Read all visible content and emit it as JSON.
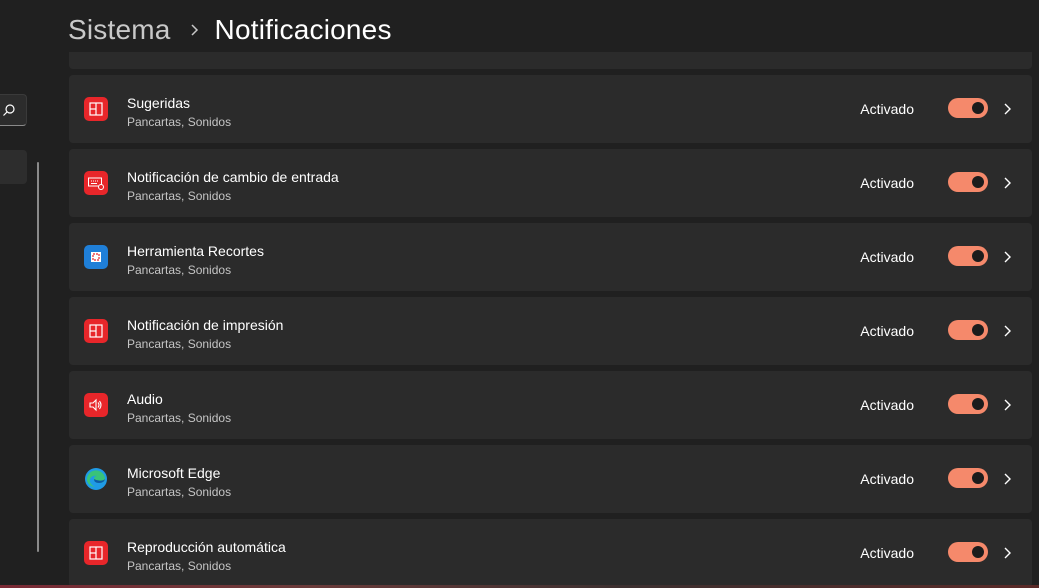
{
  "header": {
    "parent": "Sistema",
    "current": "Notificaciones"
  },
  "nav": {
    "search_icon": "search-icon"
  },
  "apps": [
    {
      "name": "Sugeridas",
      "detail": "Pancartas, Sonidos",
      "state": "Activado",
      "enabled": true,
      "icon": "suggested-icon",
      "icon_color": "#e8262a"
    },
    {
      "name": "Notificación de cambio de entrada",
      "detail": "Pancartas, Sonidos",
      "state": "Activado",
      "enabled": true,
      "icon": "keyboard-settings-icon",
      "icon_color": "#e8262a"
    },
    {
      "name": "Herramienta Recortes",
      "detail": "Pancartas, Sonidos",
      "state": "Activado",
      "enabled": true,
      "icon": "snipping-tool-icon",
      "icon_color": "#1f7fd8"
    },
    {
      "name": "Notificación de impresión",
      "detail": "Pancartas, Sonidos",
      "state": "Activado",
      "enabled": true,
      "icon": "print-notification-icon",
      "icon_color": "#e8262a"
    },
    {
      "name": "Audio",
      "detail": "Pancartas, Sonidos",
      "state": "Activado",
      "enabled": true,
      "icon": "speaker-icon",
      "icon_color": "#e8262a"
    },
    {
      "name": "Microsoft Edge",
      "detail": "Pancartas, Sonidos",
      "state": "Activado",
      "enabled": true,
      "icon": "edge-icon",
      "icon_color": "#1f9be6"
    },
    {
      "name": "Reproducción automática",
      "detail": "Pancartas, Sonidos",
      "state": "Activado",
      "enabled": true,
      "icon": "autoplay-icon",
      "icon_color": "#e8262a"
    }
  ],
  "colors": {
    "background": "#202020",
    "card": "#2b2b2b",
    "toggle_on": "#f5896b"
  }
}
